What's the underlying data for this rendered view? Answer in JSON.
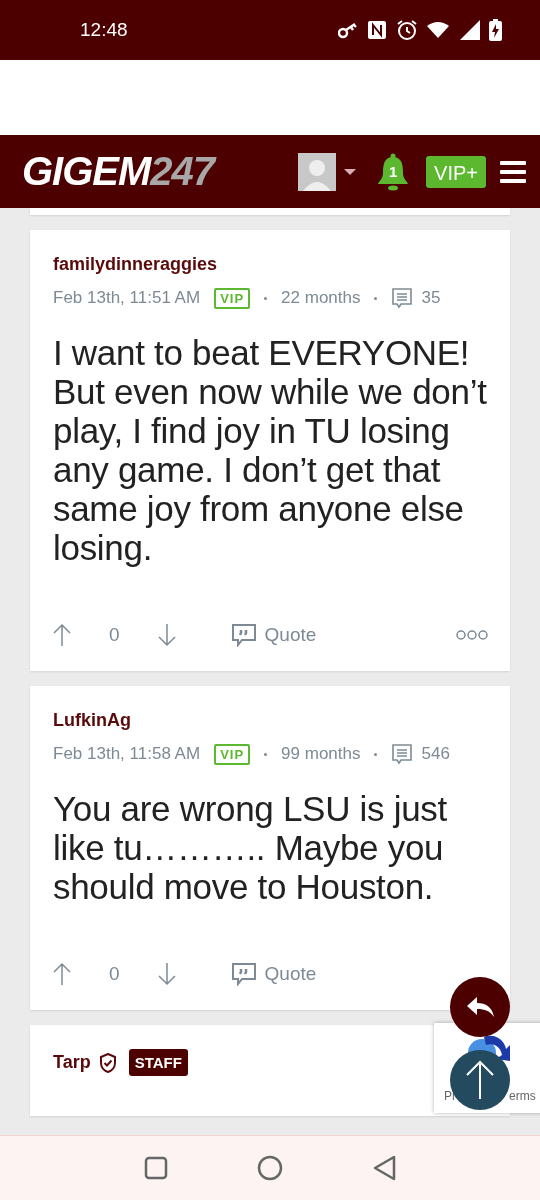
{
  "status_bar": {
    "time": "12:48"
  },
  "header": {
    "logo_main": "GIGEM",
    "logo_suffix": "247",
    "notification_count": "1",
    "vip_label": "VIP+"
  },
  "posts": [
    {
      "author": "familydinneraggies",
      "verified": false,
      "badge": {
        "kind": "vip",
        "label": "VIP"
      },
      "date": "Feb 13th, 11:51 AM",
      "tenure": "22 months",
      "post_count": "35",
      "body": "I want to beat EVERYONE! But even now while we don’t play, I find joy in TU losing any game. I don’t get that same joy from anyone else losing.",
      "votes": "0",
      "quote_label": "Quote",
      "has_more": true
    },
    {
      "author": "LufkinAg",
      "verified": false,
      "badge": {
        "kind": "vip",
        "label": "VIP"
      },
      "date": "Feb 13th, 11:58 AM",
      "tenure": "99 months",
      "post_count": "546",
      "body": "You are wrong LSU is just like tu……….. Maybe you should move to Houston.",
      "votes": "0",
      "quote_label": "Quote",
      "has_more": false
    },
    {
      "author": "Tarp",
      "verified": true,
      "badge": {
        "kind": "staff",
        "label": "STAFF"
      }
    }
  ],
  "recaptcha": {
    "left_text": "Pr",
    "right_text": "erms"
  }
}
